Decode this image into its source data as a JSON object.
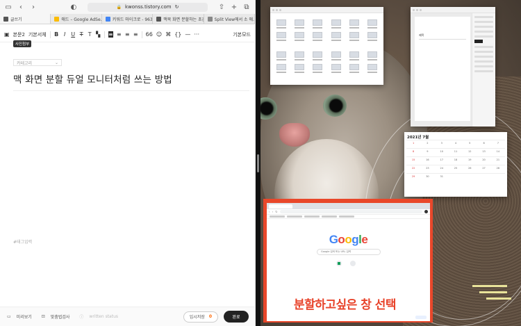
{
  "safari": {
    "url": "kwonss.tistory.com",
    "tabs": [
      {
        "label": "글쓰기",
        "color": "#555555"
      },
      {
        "label": "애드 – Google AdSe...",
        "color": "#fbbc04"
      },
      {
        "label": "키워드 마이크로 - 963...",
        "color": "#4285f4"
      },
      {
        "label": "맥북 화면 분할하는 초간...",
        "color": "#555555"
      },
      {
        "label": "Split View에서 소 애...",
        "color": "#888888"
      }
    ]
  },
  "editor": {
    "toolbar": {
      "paragraph": "본문2",
      "font": "기본서체",
      "mode": "기본모드"
    },
    "tooltip": "사진첨부",
    "category_placeholder": "카테고리",
    "post_title": "맥 화면 분할 듀얼 모니터처럼 쓰는 방법",
    "tags_placeholder": "#태그입력",
    "bottom": {
      "preview": "미리보기",
      "spellcheck": "맞춤법검사",
      "writer_status": "written status",
      "temp_save": "임시저장",
      "temp_count": "0",
      "done": "완료"
    }
  },
  "desktop": {
    "pages_doc_heading": "제목",
    "calendar_title": "2021년 7월",
    "calendar_days": [
      "1",
      "2",
      "3",
      "4",
      "5",
      "6",
      "7",
      "8",
      "9",
      "10",
      "11",
      "12",
      "13",
      "14",
      "15",
      "16",
      "17",
      "18",
      "19",
      "20",
      "21",
      "22",
      "23",
      "24",
      "25",
      "26",
      "27",
      "28",
      "29",
      "30",
      "31",
      "",
      "",
      "",
      ""
    ],
    "google_logo": [
      "G",
      "o",
      "o",
      "g",
      "l",
      "e"
    ],
    "google_colors": [
      "#4285f4",
      "#ea4335",
      "#fbbc05",
      "#4285f4",
      "#34a853",
      "#ea4335"
    ],
    "google_search_placeholder": "Google 검색 또는 URL 입력",
    "caption": "분할하고싶은 창 선택",
    "caption_color": "#e8432a"
  }
}
